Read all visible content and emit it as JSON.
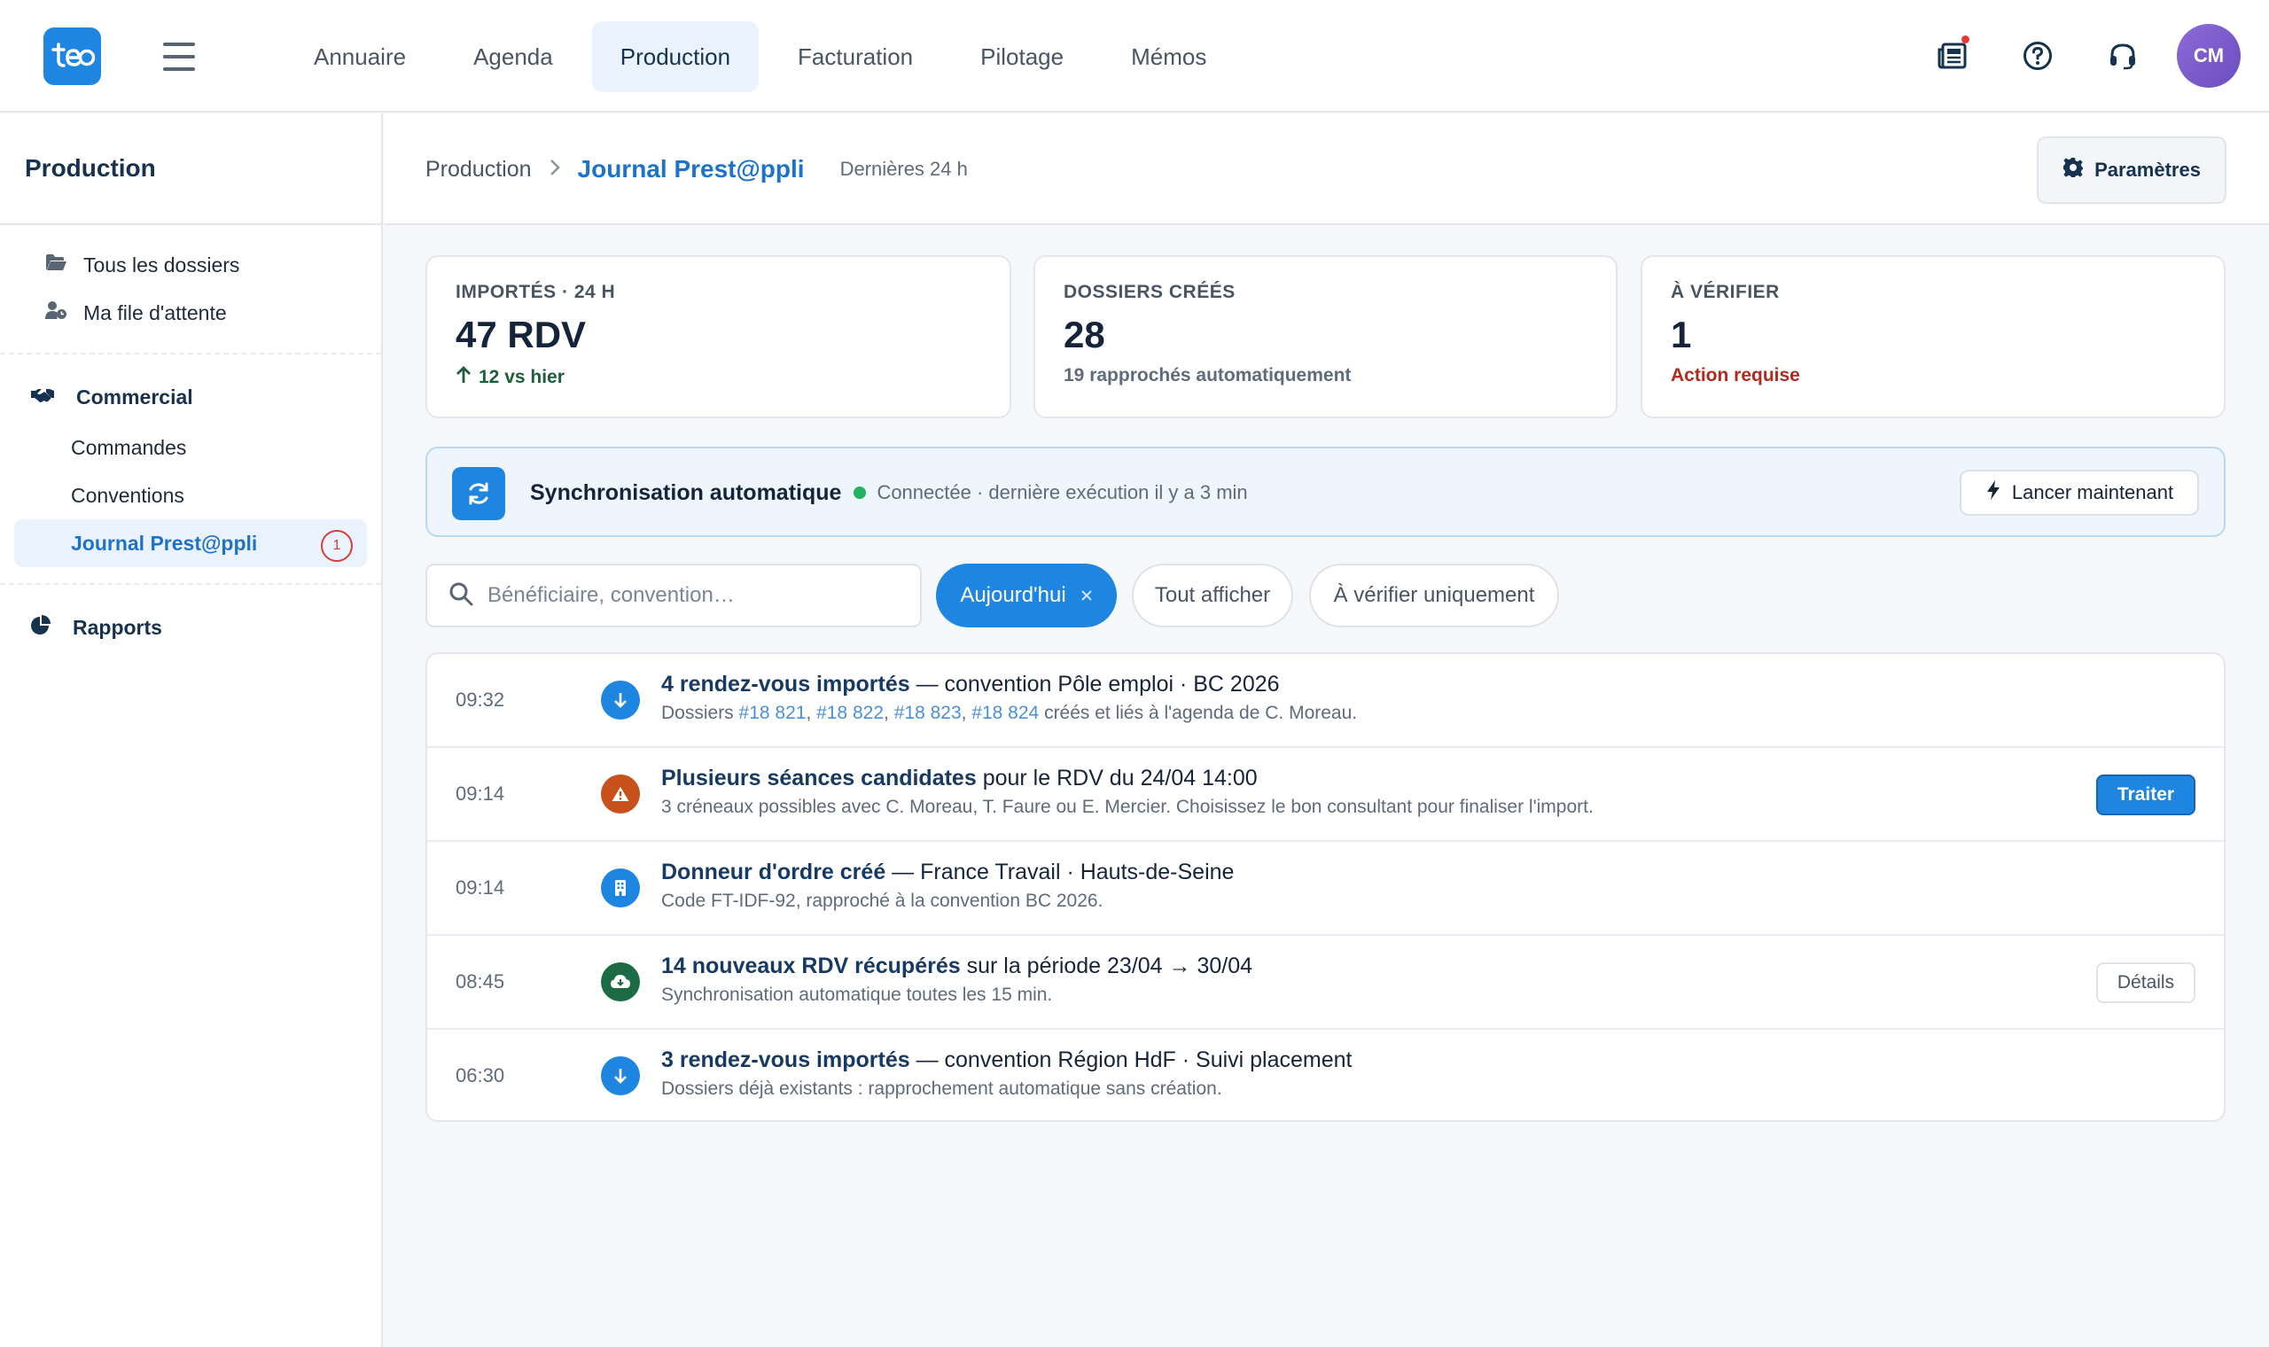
{
  "app": {
    "logo_icon": "teo-logo-icon",
    "nav": [
      {
        "label": "Annuaire"
      },
      {
        "label": "Agenda"
      },
      {
        "label": "Production",
        "active": true
      },
      {
        "label": "Facturation"
      },
      {
        "label": "Pilotage"
      },
      {
        "label": "Mémos"
      }
    ],
    "top_icons": [
      "news-icon",
      "help-icon",
      "headset-icon"
    ],
    "user_initials": "CM"
  },
  "sidebar": {
    "title": "Production",
    "links": [
      {
        "label": "Tous les dossiers",
        "icon": "folder-open-icon"
      },
      {
        "label": "Ma file d'attente",
        "icon": "user-clock-icon"
      }
    ],
    "group_commercial": {
      "label": "Commercial",
      "icon": "handshake-icon",
      "items": [
        {
          "label": "Commandes"
        },
        {
          "label": "Conventions"
        },
        {
          "label": "Journal Prest@ppli",
          "active": true,
          "badge": "1"
        }
      ]
    },
    "group_rapports": {
      "label": "Rapports",
      "icon": "pie-chart-icon"
    }
  },
  "header": {
    "breadcrumb_root": "Production",
    "breadcrumb_current": "Journal Prest@ppli",
    "period": "Dernières 24 h",
    "params_label": "Paramètres"
  },
  "kpis": [
    {
      "label": "IMPORTÉS · 24 H",
      "value": "47 RDV",
      "note": "12 vs hier",
      "note_kind": "up"
    },
    {
      "label": "DOSSIERS CRÉÉS",
      "value": "28",
      "note": "19 rapprochés automatiquement",
      "note_kind": "neutral"
    },
    {
      "label": "À VÉRIFIER",
      "value": "1",
      "note": "Action requise",
      "note_kind": "alert"
    }
  ],
  "sync": {
    "title": "Synchronisation automatique",
    "status": "Connectée · dernière exécution il y a 3 min",
    "launch_label": "Lancer maintenant"
  },
  "filters": {
    "search_placeholder": "Bénéficiaire, convention…",
    "chip_today": "Aujourd'hui",
    "chip_all": "Tout afficher",
    "chip_verify": "À vérifier uniquement"
  },
  "feed": [
    {
      "time": "09:32",
      "icon": "arrow-down-icon",
      "icon_color": "#1e86e0",
      "title": "4 rendez-vous importés",
      "rest": " — convention Pôle emploi · BC 2026",
      "sub_prefix": "Dossiers ",
      "links": [
        "#18 821",
        "#18 822",
        "#18 823",
        "#18 824"
      ],
      "sub_suffix": " créés et liés à l'agenda de C. Moreau."
    },
    {
      "time": "09:14",
      "icon": "warning-icon",
      "icon_color": "#c8501a",
      "title": "Plusieurs séances candidates",
      "rest": " pour le RDV du 24/04 14:00",
      "sub": "3 créneaux possibles avec C. Moreau, T. Faure ou E. Mercier. Choisissez le bon consultant pour finaliser l'import.",
      "action": "Traiter"
    },
    {
      "time": "09:14",
      "icon": "building-icon",
      "icon_color": "#1e86e0",
      "title": "Donneur d'ordre créé",
      "rest": " — France Travail · Hauts-de-Seine",
      "sub": "Code FT-IDF-92, rapproché à la convention BC 2026."
    },
    {
      "time": "08:45",
      "icon": "cloud-download-icon",
      "icon_color": "#1d6b45",
      "title": "14 nouveaux RDV récupérés",
      "rest": " sur la période 23/04 → 30/04",
      "sub": "Synchronisation automatique toutes les 15 min.",
      "action": "Détails"
    },
    {
      "time": "06:30",
      "icon": "arrow-down-icon",
      "icon_color": "#1e86e0",
      "title": "3 rendez-vous importés",
      "rest": " — convention Région HdF · Suivi placement",
      "sub": "Dossiers déjà existants : rapprochement automatique sans création."
    }
  ]
}
